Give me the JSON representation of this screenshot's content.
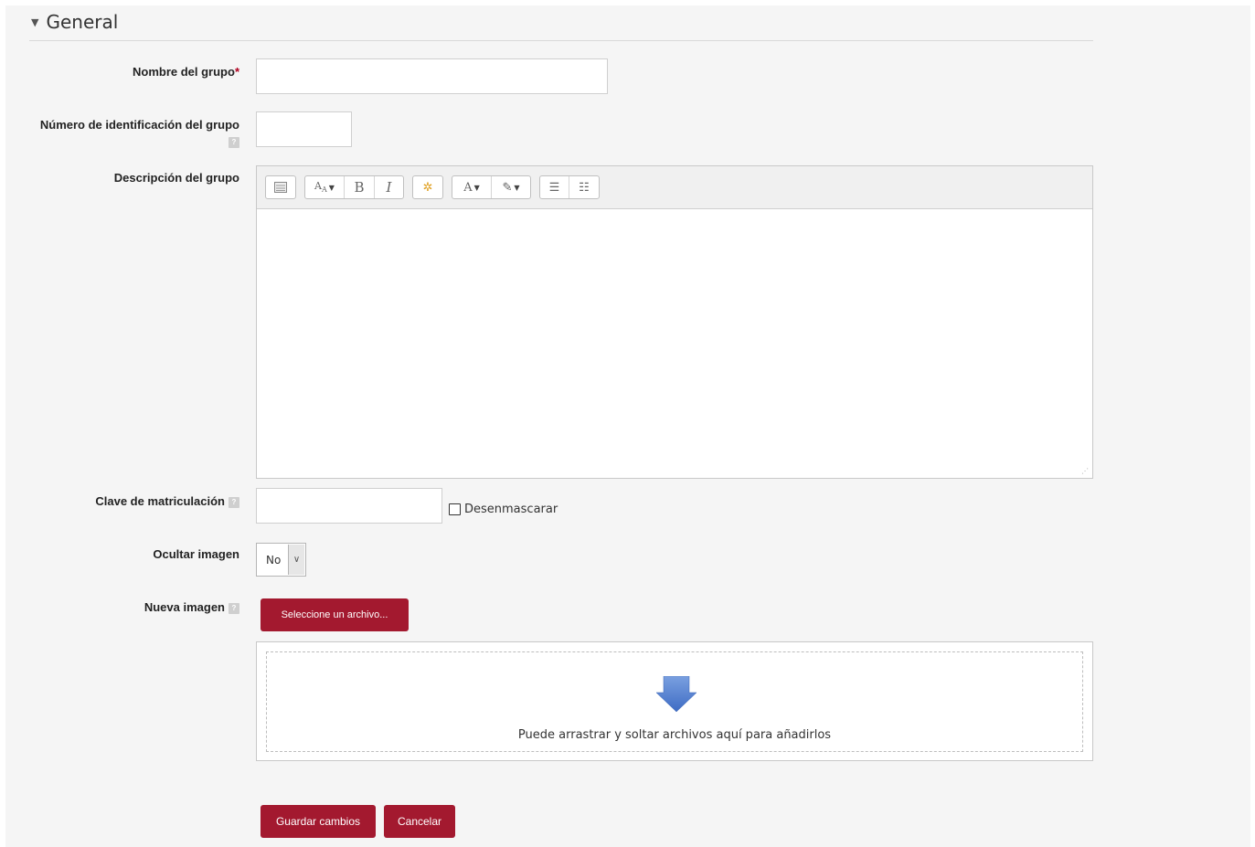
{
  "section": {
    "title": "General"
  },
  "fields": {
    "name": {
      "label": "Nombre del grupo",
      "required_mark": "*",
      "value": ""
    },
    "idnumber": {
      "label": "Número de identificación del grupo",
      "help": "?",
      "value": ""
    },
    "description": {
      "label": "Descripción del grupo",
      "value": ""
    },
    "enrolkey": {
      "label": "Clave de matriculación",
      "help": "?",
      "value": "",
      "unmask_label": "Desenmascarar"
    },
    "hidepicture": {
      "label": "Ocultar imagen",
      "value": "No"
    },
    "newpicture": {
      "label": "Nueva imagen",
      "help": "?",
      "choose_button": "Seleccione un archivo...",
      "drop_text": "Puede arrastrar y soltar archivos aquí para añadirlos"
    }
  },
  "toolbar": {
    "groups": [
      [
        "toggle-icon"
      ],
      [
        "font-size-icon",
        "bold-icon",
        "italic-icon"
      ],
      [
        "equation-icon"
      ],
      [
        "text-color-icon",
        "highlight-icon"
      ],
      [
        "bullet-list-icon",
        "numbered-list-icon"
      ]
    ]
  },
  "buttons": {
    "save": "Guardar cambios",
    "cancel": "Cancelar"
  },
  "colors": {
    "primary": "#a3192f",
    "drop_arrow": "#4a78c8"
  }
}
